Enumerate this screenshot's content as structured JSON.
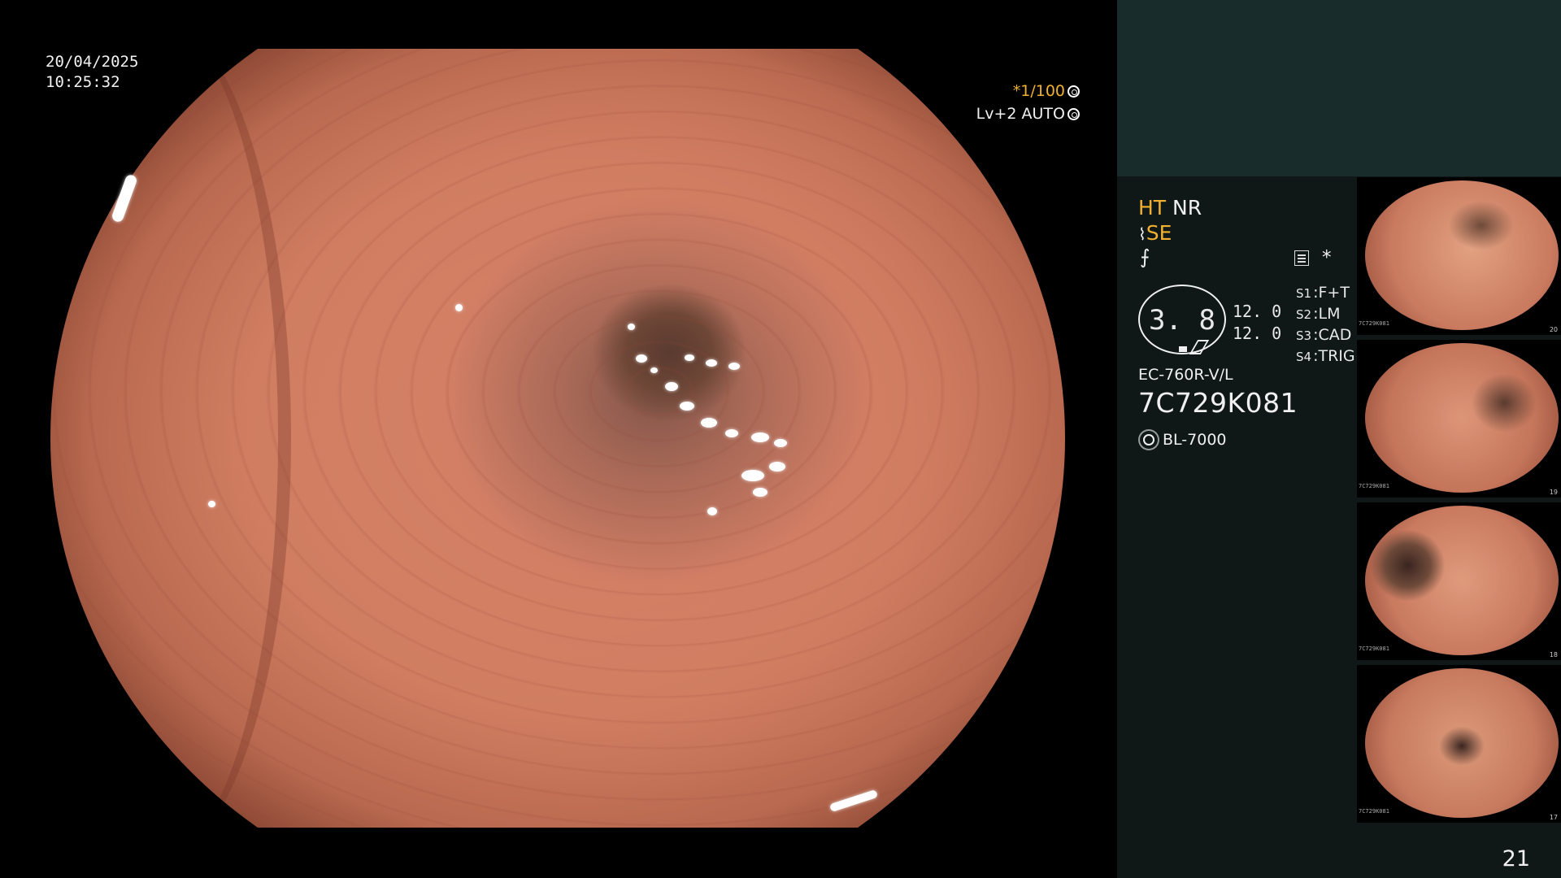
{
  "scope": {
    "date": "20/04/2025",
    "time": "10:25:32",
    "shutter": "*1/100",
    "level": "Lv+2",
    "exposure": "AUTO"
  },
  "info": {
    "mode_ht": "HT",
    "mode_nr": "NR",
    "enhance": "SE",
    "f_mark": "⨍",
    "star": "*",
    "lens_value": "3. 8",
    "lens_nums": [
      "12. 0",
      "12. 0"
    ],
    "switches": [
      {
        "key": "S1",
        "value": "F+T"
      },
      {
        "key": "S2",
        "value": "LM"
      },
      {
        "key": "S3",
        "value": "CAD"
      },
      {
        "key": "S4",
        "value": "TRIG"
      }
    ],
    "model": "EC-760R-V/L",
    "serial": "7C729K081",
    "light_source": "BL-7000"
  },
  "thumbnails": [
    {
      "serial": "7C729K081",
      "number": "20"
    },
    {
      "serial": "7C729K081",
      "number": "19"
    },
    {
      "serial": "7C729K081",
      "number": "18"
    },
    {
      "serial": "7C729K081",
      "number": "17"
    }
  ],
  "page_number": "21",
  "colors": {
    "panel_bg": "#101817",
    "header_bg": "#182d2b",
    "accent_orange": "#f0b030"
  }
}
